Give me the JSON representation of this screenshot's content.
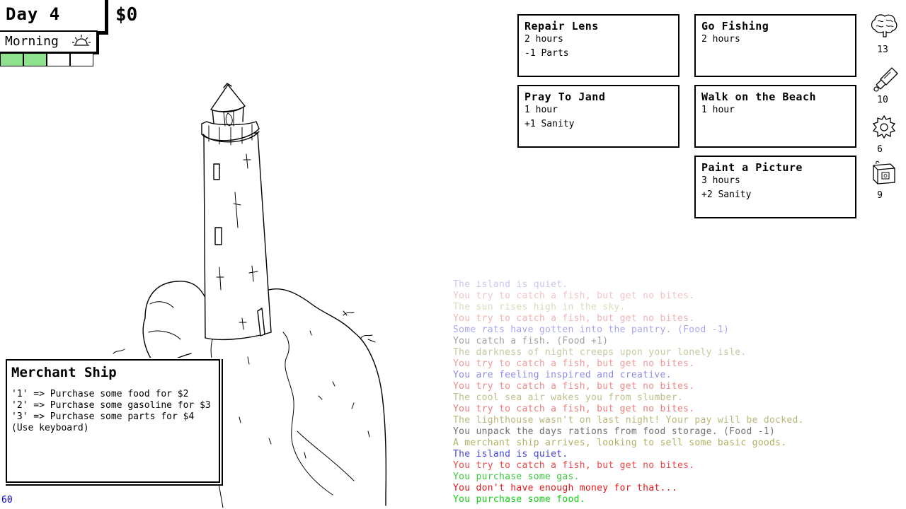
{
  "hud": {
    "day": "Day 4",
    "money": "$0",
    "time_of_day": "Morning",
    "time_segments": [
      {
        "filled": true
      },
      {
        "filled": true
      },
      {
        "filled": false
      },
      {
        "filled": false
      }
    ],
    "segment_fill_color": "#8ee28e"
  },
  "actions": [
    {
      "title": "Repair Lens",
      "lines": [
        "2 hours",
        "-1 Parts"
      ]
    },
    {
      "title": "Go Fishing",
      "lines": [
        "2 hours",
        ""
      ]
    },
    {
      "title": "Pray To Jand",
      "lines": [
        "1 hour",
        "+1 Sanity"
      ]
    },
    {
      "title": "Walk on the Beach",
      "lines": [
        "1 hour",
        ""
      ]
    },
    {
      "title": "Paint a Picture",
      "lines": [
        "3 hours",
        "+2 Sanity"
      ]
    }
  ],
  "resources": [
    {
      "icon": "brain-icon",
      "value": "13"
    },
    {
      "icon": "gas-bottle-icon",
      "value": "10"
    },
    {
      "icon": "gear-part-icon",
      "value": "6"
    },
    {
      "icon": "food-can-icon",
      "value": "9"
    }
  ],
  "log": [
    {
      "text": "The island is quiet.",
      "color": "#c8c8f2"
    },
    {
      "text": "You try to catch a fish, but get no bites.",
      "color": "#f2c4c4"
    },
    {
      "text": "The sun rises high in the sky.",
      "color": "#dcdcbc"
    },
    {
      "text": "You try to catch a fish, but get no bites.",
      "color": "#f0b4b4"
    },
    {
      "text": "Some rats have gotten into the pantry. (Food -1)",
      "color": "#a8a8ee"
    },
    {
      "text": "You catch a fish. (Food +1)",
      "color": "#a0a0a0"
    },
    {
      "text": "The darkness of night creeps upon your lonely isle.",
      "color": "#c8c8a0"
    },
    {
      "text": "You try to catch a fish, but get no bites.",
      "color": "#ee9a9a"
    },
    {
      "text": "You are feeling inspired and creative.",
      "color": "#8c8ce6"
    },
    {
      "text": "You try to catch a fish, but get no bites.",
      "color": "#ee8c8c"
    },
    {
      "text": "The cool sea air wakes you from slumber.",
      "color": "#bebe8c"
    },
    {
      "text": "You try to catch a fish, but get no bites.",
      "color": "#ec7c7c"
    },
    {
      "text": "The lighthouse wasn't on last night! Your pay will be docked.",
      "color": "#b8b87a"
    },
    {
      "text": "You unpack the days rations from food storage. (Food -1)",
      "color": "#707070"
    },
    {
      "text": "A merchant ship arrives, looking to sell some basic goods.",
      "color": "#b0b060"
    },
    {
      "text": "The island is quiet.",
      "color": "#4646dc"
    },
    {
      "text": "You try to catch a fish, but get no bites.",
      "color": "#e84848"
    },
    {
      "text": "You purchase some gas.",
      "color": "#3cc83c"
    },
    {
      "text": "You don't have enough money for that...",
      "color": "#e01818"
    },
    {
      "text": "You purchase some food.",
      "color": "#10d010"
    }
  ],
  "merchant": {
    "title": "Merchant Ship",
    "lines": [
      "'1' => Purchase some food for $2",
      "'2' => Purchase some gasoline for $3",
      "'3' => Purchase some parts for $4",
      "(Use keyboard)"
    ]
  },
  "fps": "60"
}
